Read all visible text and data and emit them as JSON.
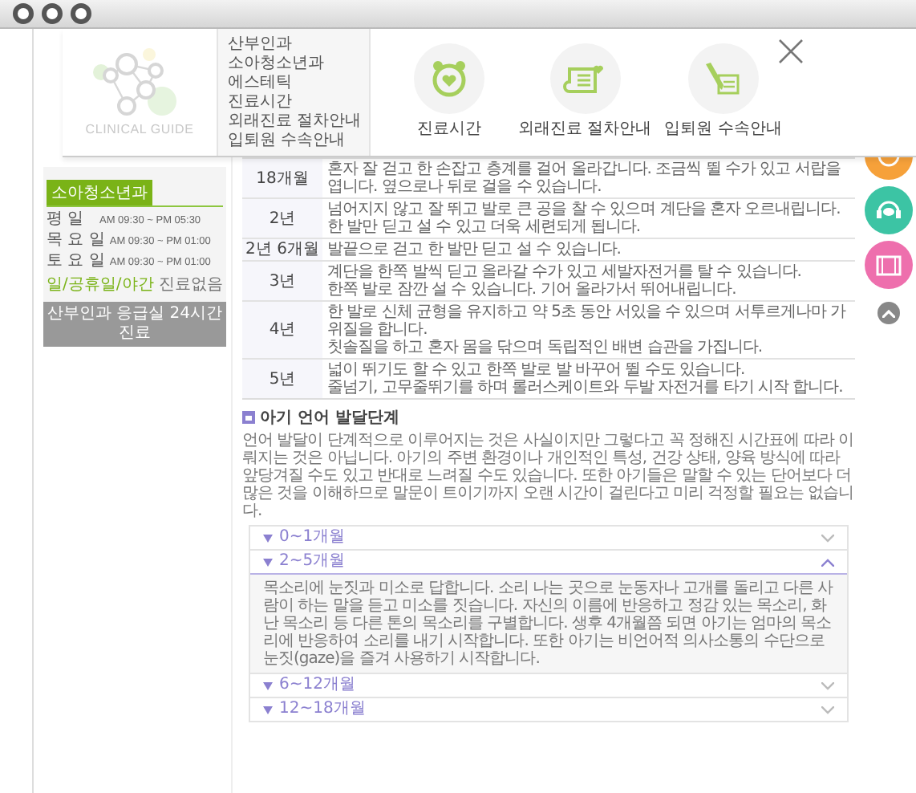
{
  "menu": {
    "logo_text": "CLINICAL GUIDE",
    "links": [
      "산부인과",
      "소아청소년과",
      "에스테틱",
      "진료시간",
      "외래진료 절차안내",
      "입퇴원 수속안내"
    ],
    "shortcuts": [
      {
        "label": "진료시간"
      },
      {
        "label": "외래진료 절차안내"
      },
      {
        "label": "입퇴원 수속안내"
      }
    ]
  },
  "sidebar": {
    "tab": "소아청소년과",
    "hours": [
      {
        "day": "평 일",
        "time": "AM 09:30 ~ PM 05:30"
      },
      {
        "day": "목 요 일",
        "time": "AM 09:30 ~ PM 01:00"
      },
      {
        "day": "토 요 일",
        "time": "AM 09:30 ~ PM 01:00"
      }
    ],
    "closed_note": {
      "highlight": "일/공휴일/야간",
      "text": "진료없음"
    },
    "emergency": "산부인과 응급실 24시간 진료"
  },
  "milestones": [
    {
      "age": "18개월",
      "lines": [
        "혼자 잘 걷고 한 손잡고 층계를 걸어 올라갑니다. 조금씩 뛸 수가 있고 서랍을 엽니다. 옆으로나 뒤로 걸을 수 있습니다."
      ]
    },
    {
      "age": "2년",
      "lines": [
        "넘어지지 않고 잘 뛰고 발로 큰 공을 찰 수 있으며 계단을 혼자 오르내립니다.",
        "한 발만 딛고 설 수 있고 더욱 세련되게 됩니다."
      ]
    },
    {
      "age": "2년 6개월",
      "lines": [
        "발끝으로 걷고 한 발만 딛고 설 수 있습니다."
      ]
    },
    {
      "age": "3년",
      "lines": [
        "계단을 한쪽 발씩 딛고 올라갈 수가 있고 세발자전거를 탈 수 있습니다.",
        "한쪽 발로 잠깐 설 수 있습니다. 기어 올라가서 뛰어내립니다."
      ]
    },
    {
      "age": "4년",
      "lines": [
        "한 발로 신체 균형을 유지하고 약 5초 동안 서있을 수 있으며 서투르게나마 가위질을 합니다.",
        "칫솔질을 하고 혼자 몸을 닦으며 독립적인 배변 습관을 가집니다."
      ]
    },
    {
      "age": "5년",
      "lines": [
        "넓이 뛰기도 할 수 있고 한쪽 발로 발 바꾸어 뛸 수도 있습니다.",
        "줄넘기, 고무줄뛰기를 하며 롤러스케이트와 두발 자전거를 타기 시작 합니다."
      ]
    }
  ],
  "language_section": {
    "title": "아기 언어 발달단계",
    "intro": "언어 발달이 단계적으로 이루어지는 것은 사실이지만 그렇다고 꼭 정해진 시간표에 따라 이뤄지는 것은 아닙니다. 아기의 주변 환경이나 개인적인 특성, 건강 상태, 양육 방식에 따라 앞당겨질 수도 있고 반대로 느려질 수도 있습니다. 또한 아기들은 말할 수 있는 단어보다 더 많은 것을 이해하므로 말문이 트이기까지 오랜 시간이 걸린다고 미리 걱정할 필요는 없습니다.",
    "stages": [
      {
        "label": "0~1개월",
        "expanded": false
      },
      {
        "label": "2~5개월",
        "expanded": true,
        "body": "목소리에 눈짓과 미소로 답합니다. 소리 나는 곳으로 눈동자나 고개를 돌리고 다른 사람이 하는 말을 듣고 미소를 짓습니다. 자신의 이름에 반응하고 정감 있는 목소리, 화난 목소리 등 다른 톤의 목소리를 구별합니다. 생후 4개월쯤 되면 아기는 엄마의 목소리에 반응하여 소리를 내기 시작합니다. 또한 아기는 비언어적 의사소통의 수단으로 눈짓(gaze)을 즐겨 사용하기 시작합니다."
      },
      {
        "label": "6~12개월",
        "expanded": false
      },
      {
        "label": "12~18개월",
        "expanded": false
      }
    ]
  }
}
